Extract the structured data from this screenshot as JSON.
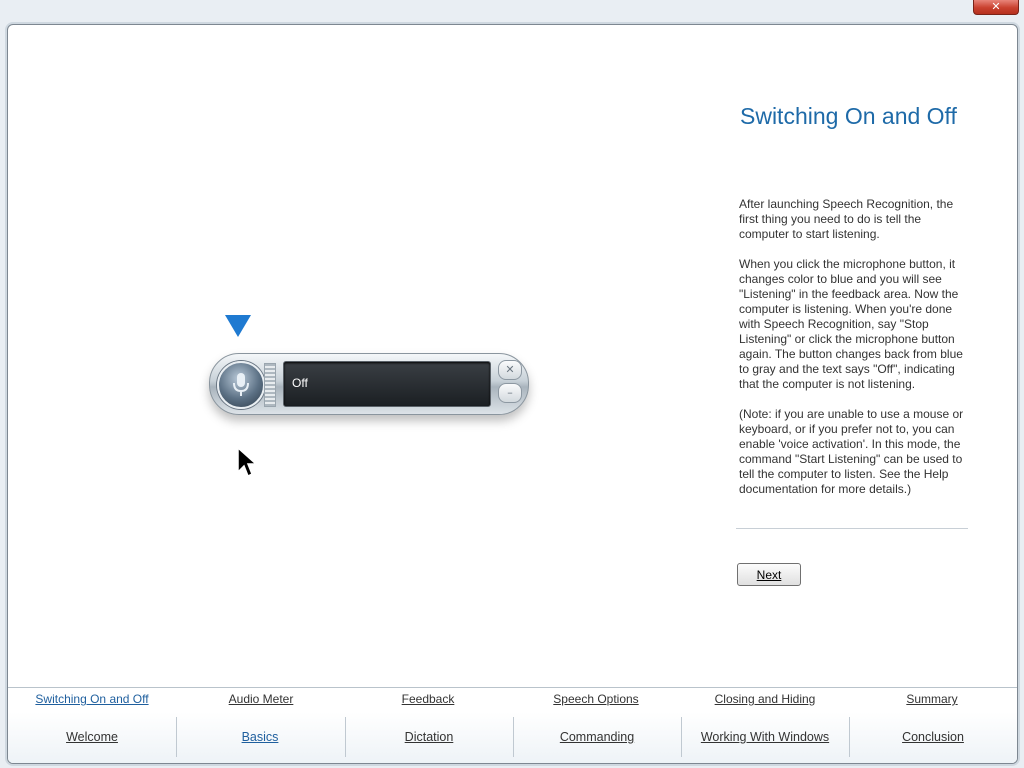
{
  "window": {
    "close_glyph": "✕"
  },
  "demo": {
    "display_text": "Off",
    "close_glyph": "✕",
    "minimize_glyph": "–",
    "icons": {
      "pointer": "triangle-down-icon",
      "mic": "microphone-icon",
      "cursor": "mouse-cursor-icon"
    }
  },
  "panel": {
    "title": "Switching On and Off",
    "paragraphs": [
      "After launching Speech Recognition, the first thing you need to do is tell the computer to start listening.",
      "When you click the microphone button, it changes color to blue and you will see \"Listening\" in the feedback area. Now the computer is listening. When you're done with Speech Recognition, say \"Stop Listening\" or click the microphone button again. The button changes back from blue to gray and the text says \"Off\", indicating that the computer is not listening.",
      "(Note: if you are unable to use a mouse or keyboard, or if you prefer not to, you can enable 'voice activation'. In this mode, the command \"Start Listening\" can be used to tell the computer to listen. See the Help documentation for more details.)"
    ],
    "next_label": "Next"
  },
  "subnav": {
    "items": [
      {
        "label": "Switching On and Off",
        "active": true
      },
      {
        "label": "Audio Meter"
      },
      {
        "label": "Feedback"
      },
      {
        "label": "Speech Options"
      },
      {
        "label": "Closing and Hiding"
      },
      {
        "label": "Summary"
      }
    ]
  },
  "mainnav": {
    "items": [
      {
        "label": "Welcome"
      },
      {
        "label": "Basics",
        "active": true
      },
      {
        "label": "Dictation"
      },
      {
        "label": "Commanding"
      },
      {
        "label": "Working With Windows"
      },
      {
        "label": "Conclusion"
      }
    ]
  },
  "colors": {
    "accent": "#1e6aa8",
    "pointer": "#1f7ad1"
  }
}
